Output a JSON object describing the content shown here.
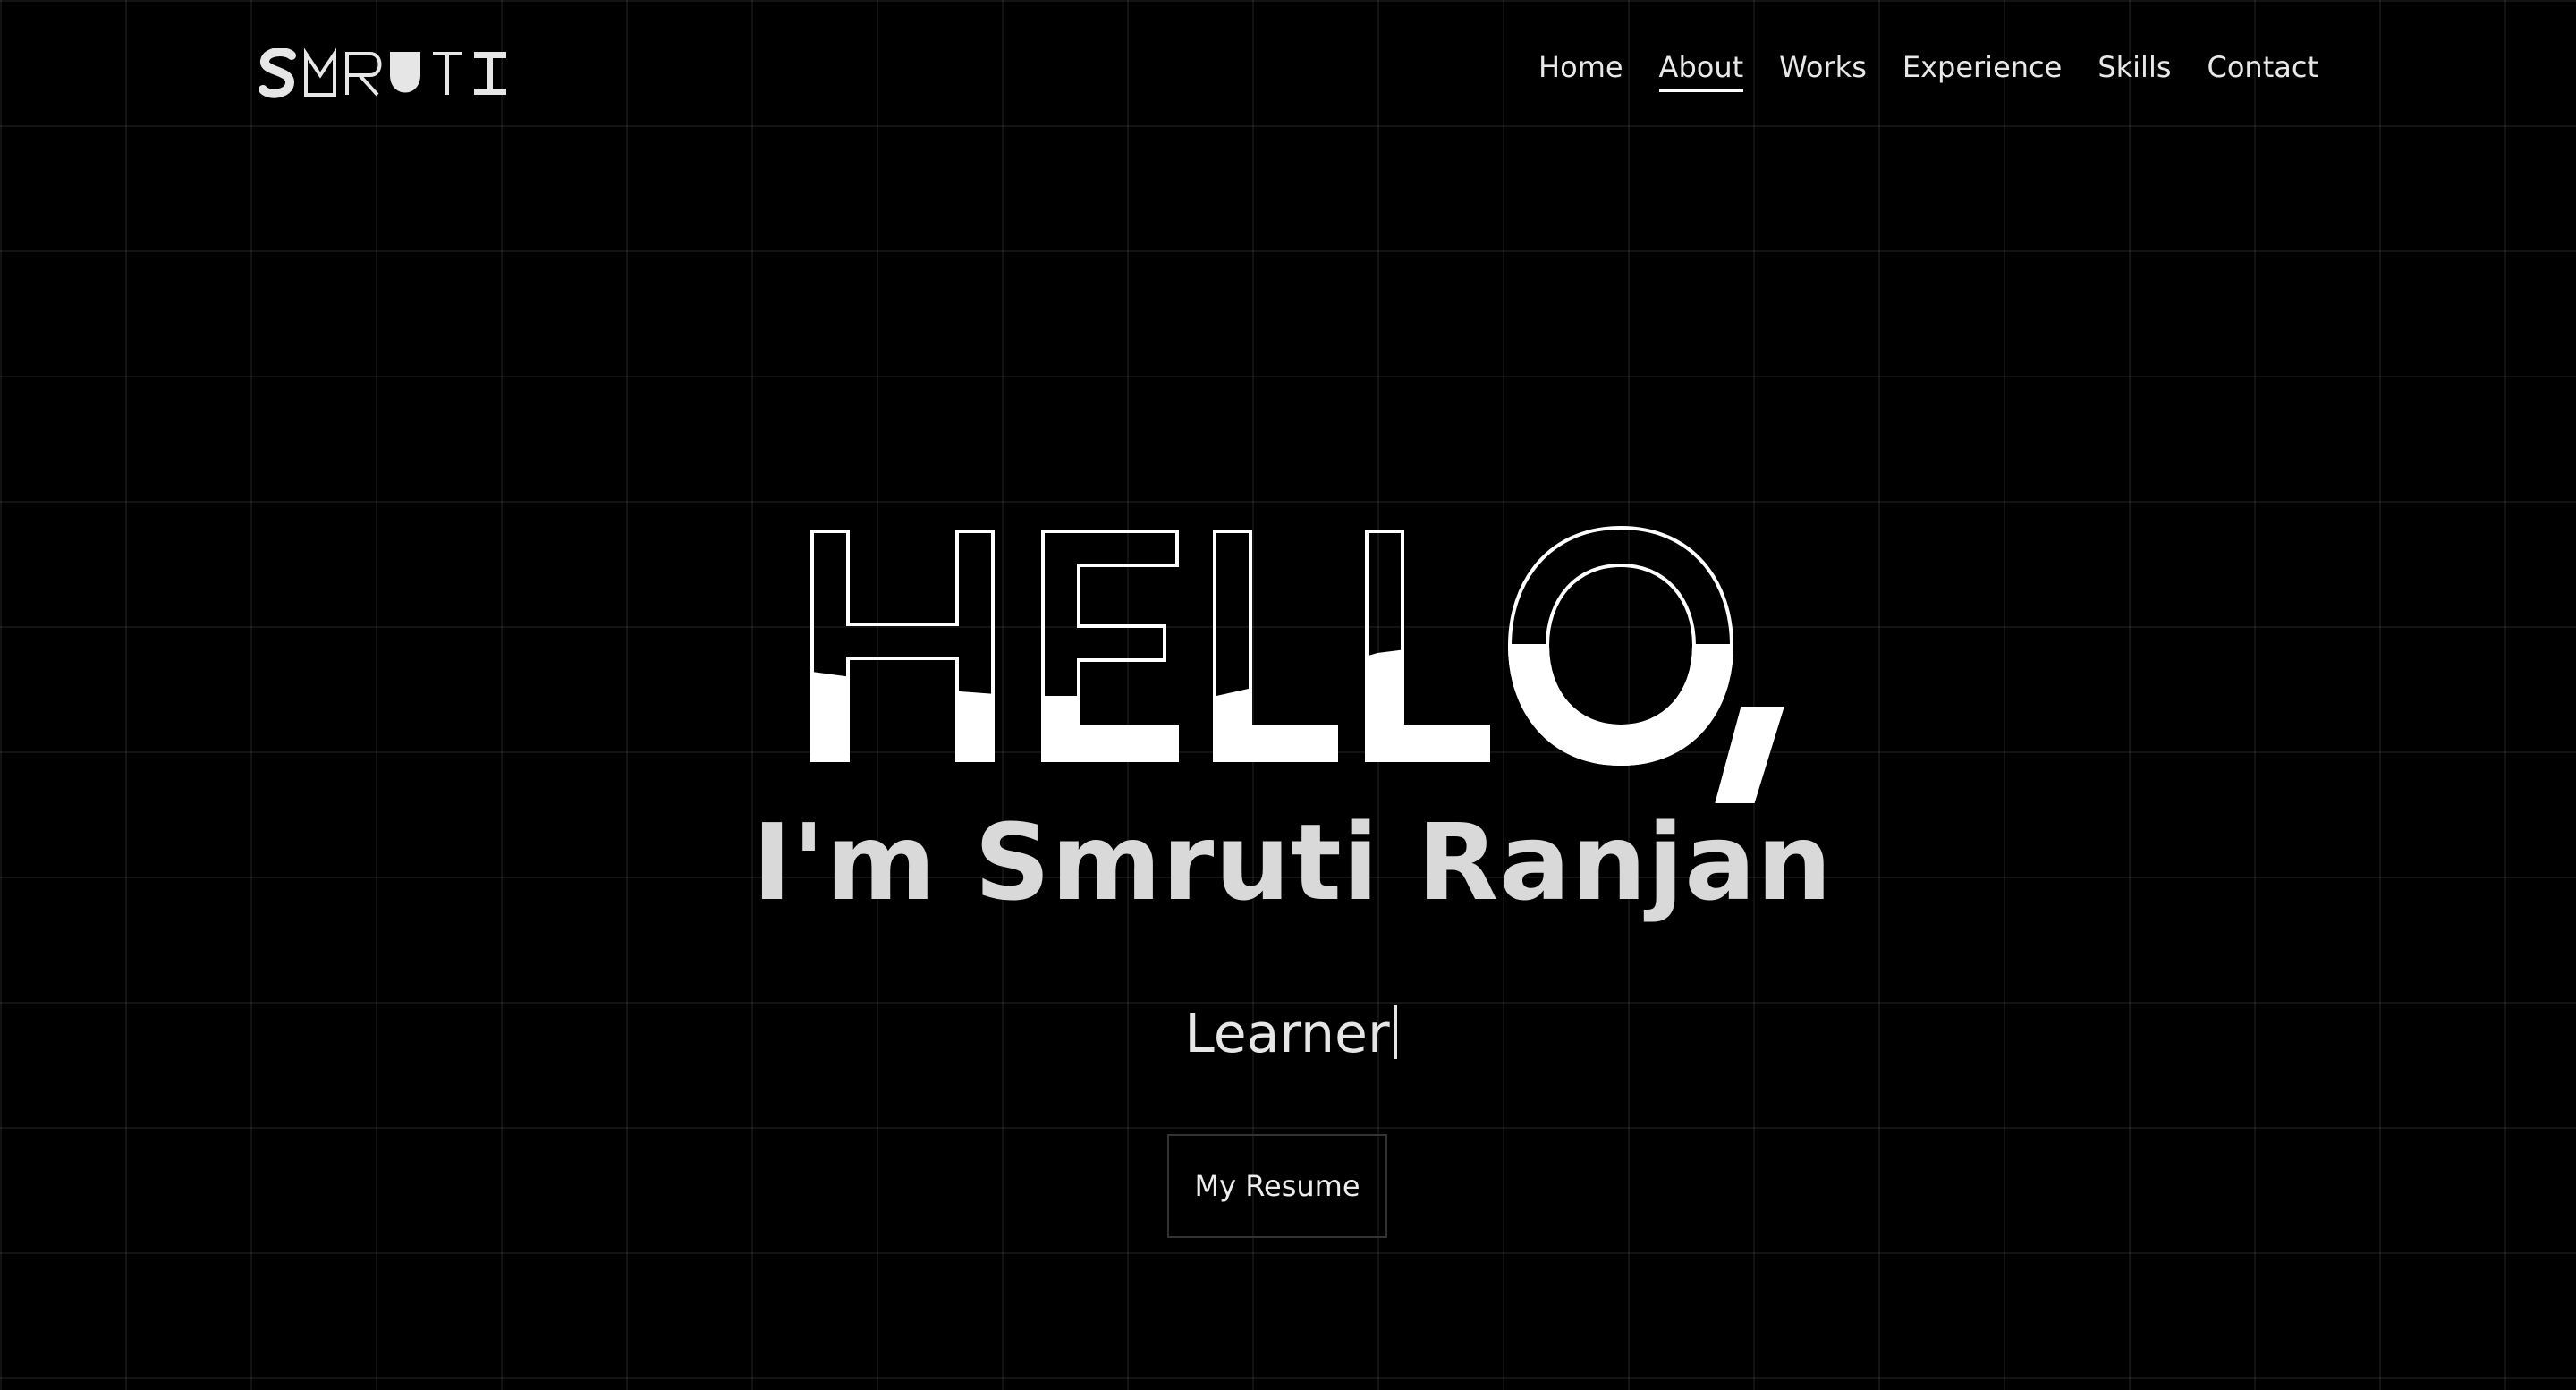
{
  "brand": {
    "logo_text": "SMRUTI",
    "logo_icon": "smruti-wordmark"
  },
  "nav": {
    "items": [
      {
        "label": "Home",
        "active": false
      },
      {
        "label": "About",
        "active": true
      },
      {
        "label": "Works",
        "active": false
      },
      {
        "label": "Experience",
        "active": false
      },
      {
        "label": "Skills",
        "active": false
      },
      {
        "label": "Contact",
        "active": false
      }
    ]
  },
  "hero": {
    "greeting": "HELLO,",
    "name": "I'm Smruti Ranjan",
    "role": "Learner",
    "resume_button": "My Resume"
  },
  "colors": {
    "background": "#000000",
    "grid_line": "#1a1a1a",
    "text_primary": "#ffffff",
    "text_secondary": "#d9d9d9",
    "button_border": "#333333"
  }
}
